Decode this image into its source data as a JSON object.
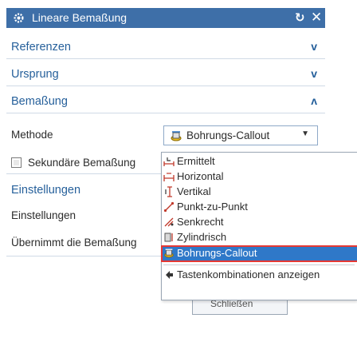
{
  "dialog": {
    "title": "Lineare Bemaßung",
    "reset_icon": "reset-icon",
    "close_icon": "close-icon",
    "accent": "#3e6fa8"
  },
  "sections": {
    "referenzen": {
      "label": "Referenzen",
      "chevron": "v"
    },
    "ursprung": {
      "label": "Ursprung",
      "chevron": "v"
    },
    "bemassung": {
      "label": "Bemaßung",
      "chevron": "ʌ"
    }
  },
  "methode": {
    "label": "Methode",
    "value": "Bohrungs-Callout"
  },
  "sekundaer": {
    "label": "Sekundäre Bemaßung"
  },
  "einstellungen": {
    "header": "Einstellungen",
    "row_label": "Einstellungen",
    "inherit_label": "Übernimmt die Bemaßung"
  },
  "dropdown": {
    "items": [
      {
        "label": "Ermittelt",
        "icon": "inferred-dimension-icon"
      },
      {
        "label": "Horizontal",
        "icon": "horizontal-dimension-icon"
      },
      {
        "label": "Vertikal",
        "icon": "vertical-dimension-icon"
      },
      {
        "label": "Punkt-zu-Punkt",
        "icon": "point-to-point-icon"
      },
      {
        "label": "Senkrecht",
        "icon": "perpendicular-icon"
      },
      {
        "label": "Zylindrisch",
        "icon": "cylindrical-icon"
      },
      {
        "label": "Bohrungs-Callout",
        "icon": "hole-callout-icon",
        "selected": true
      },
      {
        "label": "Tastenkombinationen anzeigen",
        "icon": "shortcuts-icon"
      }
    ],
    "selection_color": "#2f78c8",
    "highlight_border": "#e53935"
  },
  "button": {
    "label": "Schließen"
  }
}
